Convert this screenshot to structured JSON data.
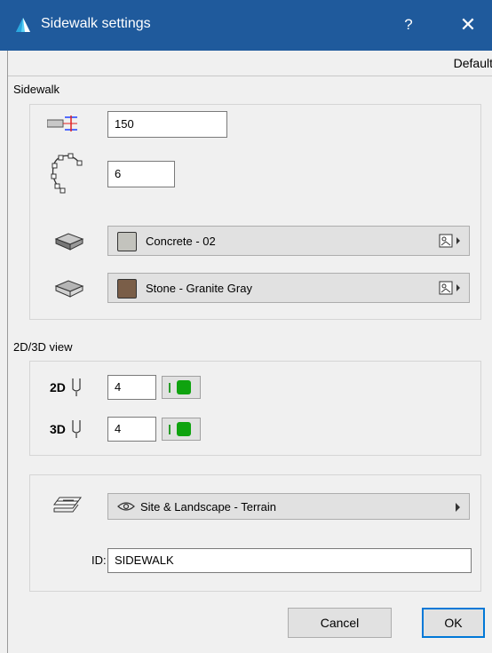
{
  "window": {
    "title": "Sidewalk settings",
    "help_label": "?",
    "close_label": "✕"
  },
  "favorites": {
    "default_label": "Default"
  },
  "sidewalk": {
    "section_label": "Sidewalk",
    "width_value": "150",
    "segments_value": "6",
    "top_surface": {
      "label": "Concrete - 02",
      "color": "#c3c3bd"
    },
    "side_surface": {
      "label": "Stone - Granite Gray",
      "color": "#7a5e48"
    }
  },
  "view": {
    "section_label": "2D/3D view",
    "pen_2d": {
      "prefix": "2D",
      "value": "4"
    },
    "pen_3d": {
      "prefix": "3D",
      "value": "4"
    },
    "pen_color": "#0fa30f"
  },
  "layer": {
    "label": "Site & Landscape - Terrain"
  },
  "id_field": {
    "label": "ID:",
    "value": "SIDEWALK"
  },
  "buttons": {
    "cancel": "Cancel",
    "ok": "OK"
  }
}
